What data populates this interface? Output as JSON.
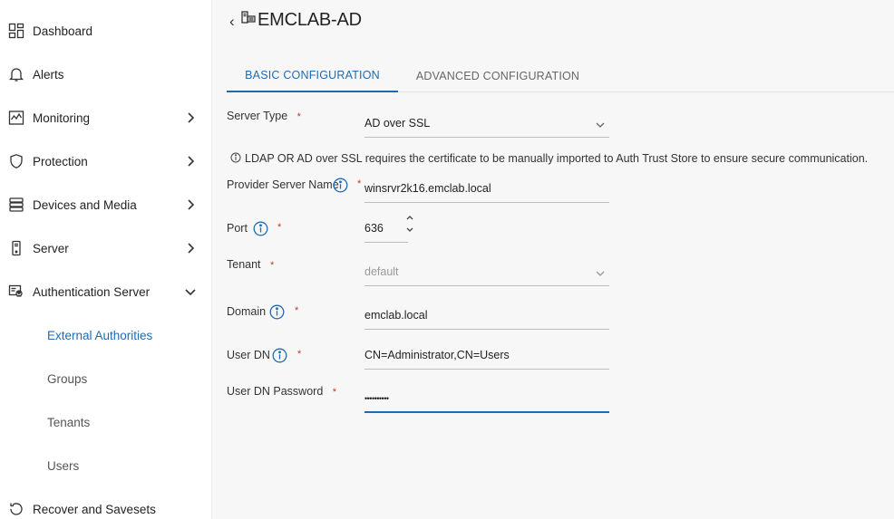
{
  "sidebar": {
    "items": [
      {
        "label": "Dashboard",
        "icon": "dashboard-icon"
      },
      {
        "label": "Alerts",
        "icon": "bell-icon"
      },
      {
        "label": "Monitoring",
        "icon": "monitoring-icon"
      },
      {
        "label": "Protection",
        "icon": "shield-icon"
      },
      {
        "label": "Devices and Media",
        "icon": "storage-icon"
      },
      {
        "label": "Server",
        "icon": "server-icon"
      },
      {
        "label": "Authentication Server",
        "icon": "auth-server-icon"
      }
    ],
    "subitems": [
      {
        "label": "External Authorities",
        "active": true
      },
      {
        "label": "Groups"
      },
      {
        "label": "Tenants"
      },
      {
        "label": "Users"
      }
    ],
    "last_item": {
      "label": "Recover and Savesets"
    }
  },
  "header": {
    "back": "‹",
    "title": "EMCLAB-AD"
  },
  "tabs": [
    {
      "label": "BASIC CONFIGURATION",
      "active": true
    },
    {
      "label": "ADVANCED CONFIGURATION"
    }
  ],
  "form": {
    "server_type": {
      "label": "Server Type",
      "required": "*",
      "value": "AD over SSL"
    },
    "note": "LDAP OR AD over SSL requires the certificate to be manually imported to Auth Trust Store to ensure secure communication.",
    "provider_server_name": {
      "label": "Provider Server Name",
      "required": "*",
      "value": "winsrvr2k16.emclab.local"
    },
    "port": {
      "label": "Port",
      "required": "*",
      "value": "636"
    },
    "tenant": {
      "label": "Tenant",
      "required": "*",
      "value": "default"
    },
    "domain": {
      "label": "Domain",
      "required": "*",
      "value": "emclab.local"
    },
    "user_dn": {
      "label": "User DN",
      "required": "*",
      "value": "CN=Administrator,CN=Users"
    },
    "user_dn_password": {
      "label": "User DN Password",
      "required": "*",
      "value": "••••••••••"
    }
  },
  "colors": {
    "accent": "#1f6bb3",
    "required": "#c0392b"
  }
}
